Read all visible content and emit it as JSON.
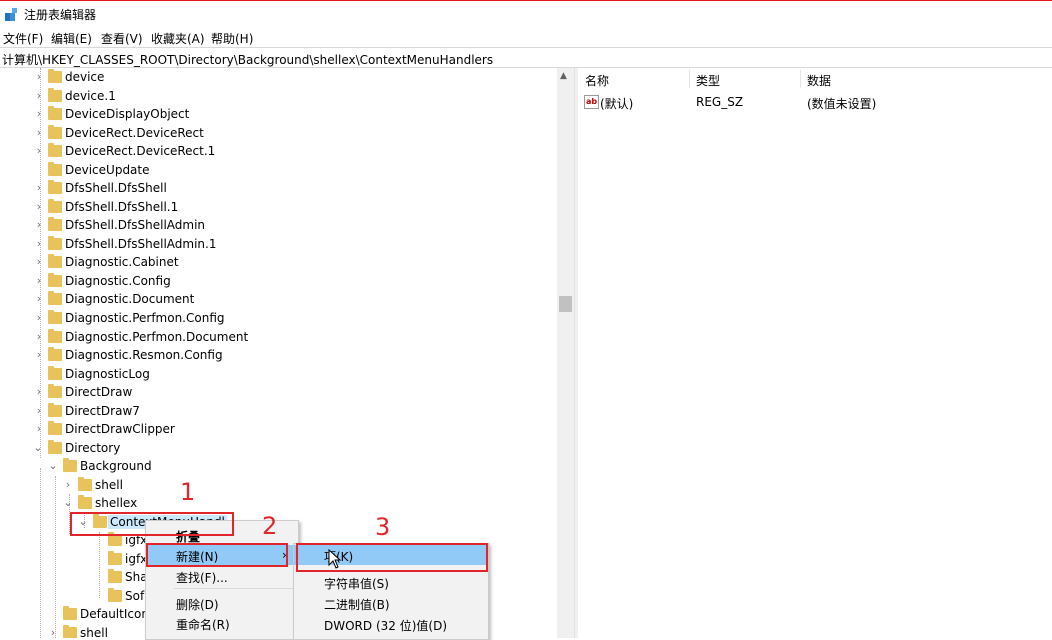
{
  "window": {
    "title": "注册表编辑器",
    "icon": "registry-editor-icon"
  },
  "menubar": [
    "文件(F)",
    "编辑(E)",
    "查看(V)",
    "收藏夹(A)",
    "帮助(H)"
  ],
  "address": "计算机\\HKEY_CLASSES_ROOT\\Directory\\Background\\shellex\\ContextMenuHandlers",
  "tree": {
    "items": [
      {
        "label": "device",
        "expander": "collapsed"
      },
      {
        "label": "device.1",
        "expander": "collapsed"
      },
      {
        "label": "DeviceDisplayObject",
        "expander": "collapsed"
      },
      {
        "label": "DeviceRect.DeviceRect",
        "expander": "collapsed"
      },
      {
        "label": "DeviceRect.DeviceRect.1",
        "expander": "collapsed"
      },
      {
        "label": "DeviceUpdate",
        "expander": "none"
      },
      {
        "label": "DfsShell.DfsShell",
        "expander": "collapsed"
      },
      {
        "label": "DfsShell.DfsShell.1",
        "expander": "collapsed"
      },
      {
        "label": "DfsShell.DfsShellAdmin",
        "expander": "collapsed"
      },
      {
        "label": "DfsShell.DfsShellAdmin.1",
        "expander": "collapsed"
      },
      {
        "label": "Diagnostic.Cabinet",
        "expander": "collapsed"
      },
      {
        "label": "Diagnostic.Config",
        "expander": "collapsed"
      },
      {
        "label": "Diagnostic.Document",
        "expander": "collapsed"
      },
      {
        "label": "Diagnostic.Perfmon.Config",
        "expander": "collapsed"
      },
      {
        "label": "Diagnostic.Perfmon.Document",
        "expander": "collapsed"
      },
      {
        "label": "Diagnostic.Resmon.Config",
        "expander": "collapsed"
      },
      {
        "label": "DiagnosticLog",
        "expander": "none"
      },
      {
        "label": "DirectDraw",
        "expander": "collapsed"
      },
      {
        "label": "DirectDraw7",
        "expander": "collapsed"
      },
      {
        "label": "DirectDrawClipper",
        "expander": "collapsed"
      },
      {
        "label": "Directory",
        "expander": "expanded"
      },
      {
        "label": "Background",
        "expander": "expanded"
      },
      {
        "label": "shell",
        "expander": "collapsed"
      },
      {
        "label": "shellex",
        "expander": "expanded"
      },
      {
        "label": "ContextMenuHandl",
        "expander": "expanded"
      },
      {
        "label": "igfx",
        "expander": "none"
      },
      {
        "label": "igfx",
        "expander": "none"
      },
      {
        "label": "Sha",
        "expander": "none"
      },
      {
        "label": "Sof",
        "expander": "none"
      },
      {
        "label": "DefaultIcon",
        "expander": "none"
      },
      {
        "label": "shell",
        "expander": "collapsed"
      }
    ]
  },
  "values": {
    "headers": {
      "name": "名称",
      "type": "类型",
      "data": "数据"
    },
    "rows": [
      {
        "name": "(默认)",
        "type": "REG_SZ",
        "data": "(数值未设置)",
        "icon": "string-value-icon"
      }
    ]
  },
  "context_menu": {
    "items": [
      "折叠",
      "新建(N)",
      "查找(F)...",
      "删除(D)",
      "重命名(R)"
    ],
    "highlighted": "新建(N)"
  },
  "submenu": {
    "items": [
      "项(K)",
      "字符串值(S)",
      "二进制值(B)",
      "DWORD (32 位)值(D)"
    ],
    "highlighted": "项(K)"
  },
  "annotations": {
    "numbers": [
      "1",
      "2",
      "3"
    ],
    "color": "#e0262b"
  },
  "colors": {
    "folder": "#e8c25b",
    "menu_highlight": "#91c9f7",
    "menu_bg": "#f2f2f2"
  }
}
